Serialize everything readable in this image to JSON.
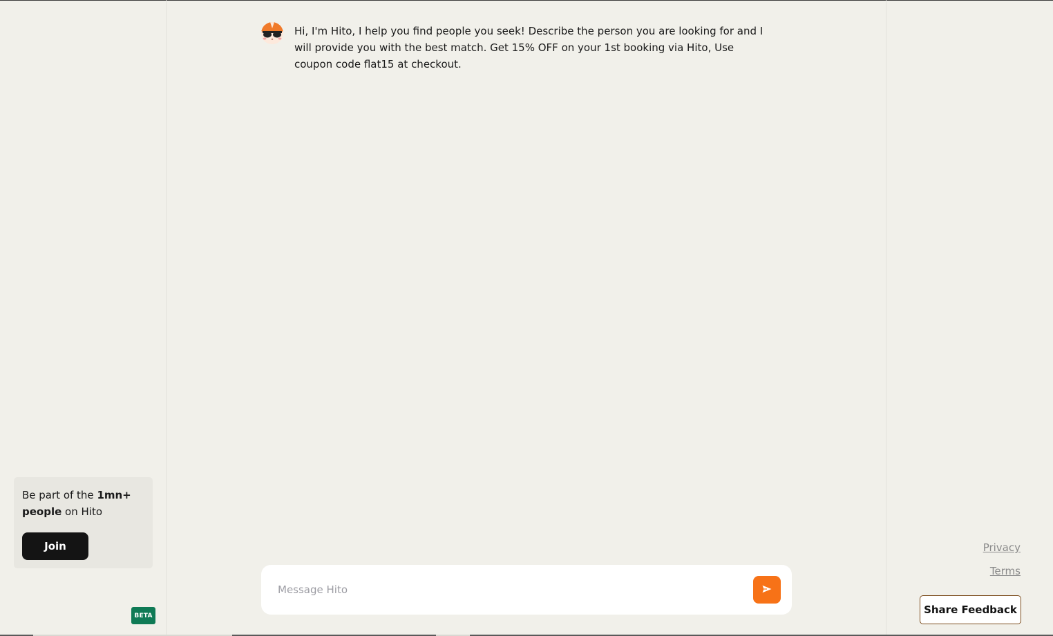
{
  "sidebar": {
    "join_card": {
      "text_prefix": "Be part of the ",
      "text_bold": "1mn+ people",
      "text_suffix": " on Hito",
      "join_label": "Join"
    },
    "beta_label": "BETA"
  },
  "chat": {
    "assistant_icon": "hito-avatar-icon",
    "messages": [
      {
        "sender": "Hito",
        "text": "Hi, I'm Hito, I help you find people you seek! Describe the person you are looking for and I will provide you with the best match. Get 15% OFF on your 1st booking via Hito, Use coupon code flat15 at checkout."
      }
    ],
    "composer": {
      "placeholder": "Message Hito",
      "value": "",
      "send_icon": "send-icon"
    }
  },
  "footer": {
    "privacy_label": "Privacy",
    "terms_label": "Terms",
    "feedback_label": "Share Feedback"
  },
  "colors": {
    "background": "#f1f0ea",
    "accent": "#f77217",
    "join_button": "#141414",
    "beta_badge": "#0f7a55"
  }
}
